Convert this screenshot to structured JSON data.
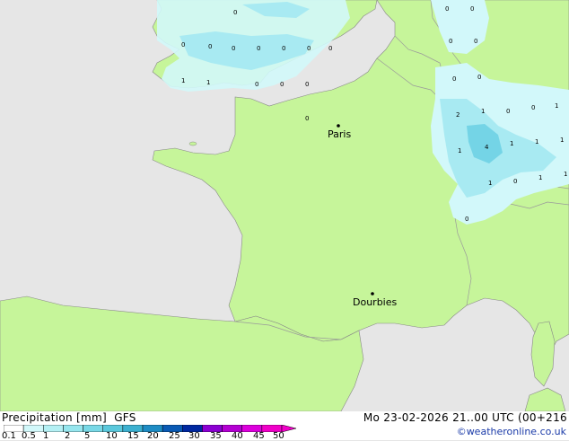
{
  "header": {
    "title": "Precipitation [mm]",
    "model": "GFS",
    "datetime": "Mo 23-02-2026 21..00 UTC (00+216",
    "credit": "©weatheronline.co.uk"
  },
  "legend": {
    "ticks": [
      "0.1",
      "0.5",
      "1",
      "2",
      "5",
      "10",
      "15",
      "20",
      "25",
      "30",
      "35",
      "40",
      "45",
      "50"
    ],
    "colors": [
      "#ffffff",
      "#d2f8fa",
      "#b4f0f4",
      "#96e6ee",
      "#78d8e6",
      "#5ac8dc",
      "#3cb0d0",
      "#1e8cc4",
      "#0a5ab4",
      "#0028a0",
      "#8c00d2",
      "#b400d2",
      "#dc00dc",
      "#f000c8"
    ]
  },
  "colors": {
    "land": "#c6f59a",
    "sea": "#e6e6e6",
    "border": "#9a9a9a",
    "precip_light": "#d2f8fa",
    "precip_med": "#a8eaf2",
    "precip_heavy": "#74d4e6"
  },
  "cities": [
    {
      "name": "Paris"
    },
    {
      "name": "Dourbies"
    }
  ],
  "values": [
    "0",
    "0",
    "0",
    "0",
    "0",
    "0",
    "0",
    "0",
    "1",
    "1",
    "0",
    "0",
    "0",
    "0",
    "0",
    "0",
    "0",
    "0",
    "0",
    "2",
    "1",
    "0",
    "0",
    "1",
    "1",
    "4",
    "1",
    "1",
    "1",
    "1",
    "0",
    "1",
    "1",
    "0",
    "0"
  ]
}
